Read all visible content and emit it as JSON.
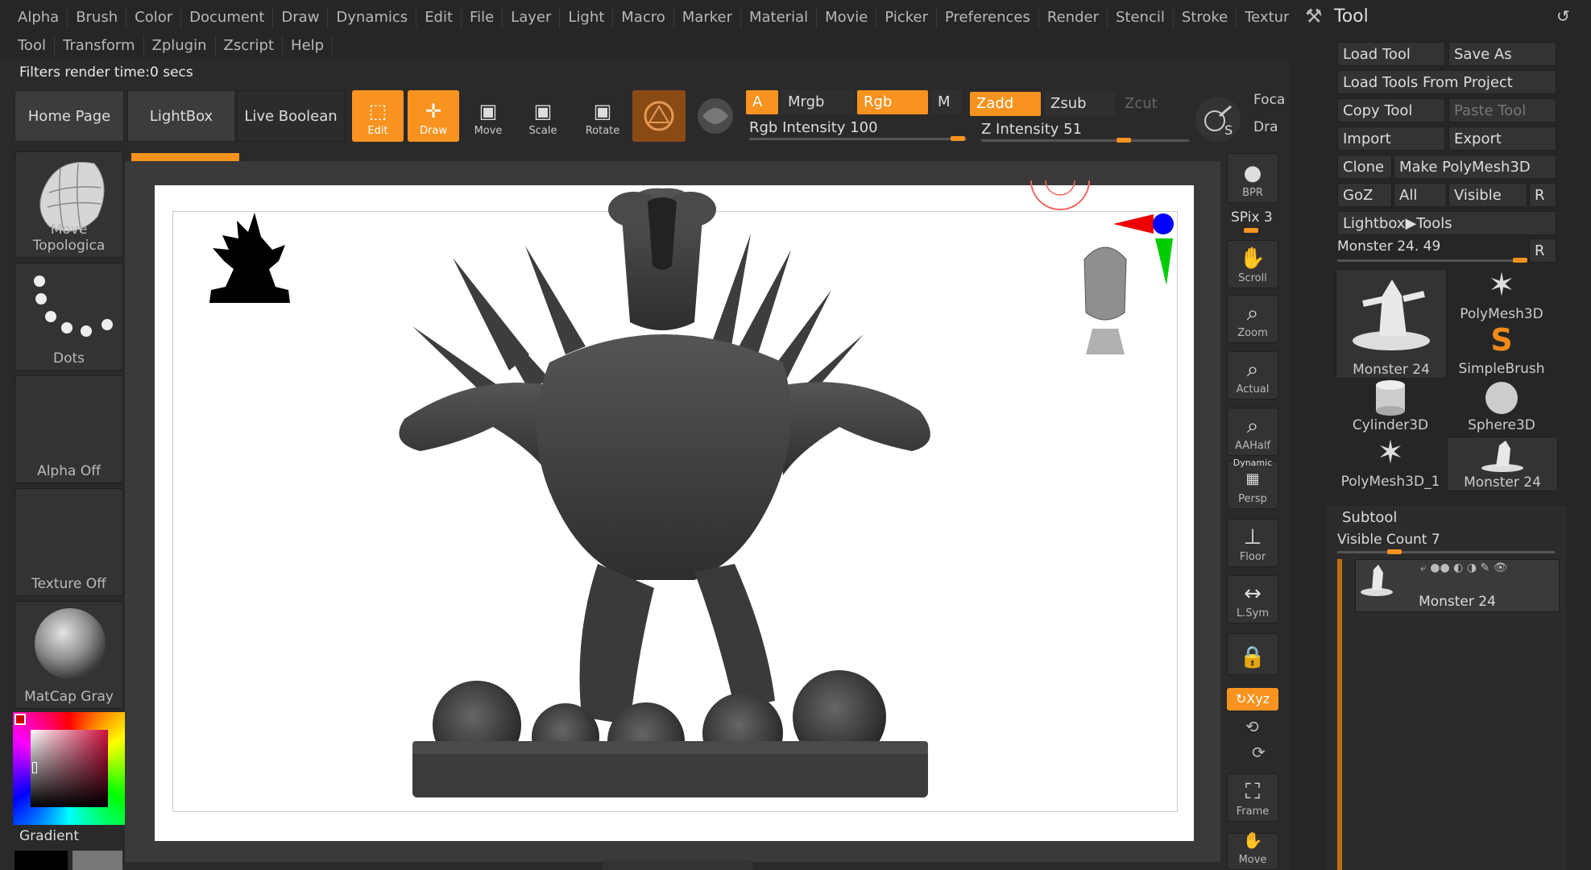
{
  "menu": {
    "row1": [
      "Alpha",
      "Brush",
      "Color",
      "Document",
      "Draw",
      "Dynamics",
      "Edit",
      "File",
      "Layer",
      "Light",
      "Macro",
      "Marker",
      "Material",
      "Movie",
      "Picker",
      "Preferences",
      "Render",
      "Stencil",
      "Stroke",
      "Texture"
    ],
    "row2": [
      "Tool",
      "Transform",
      "Zplugin",
      "Zscript",
      "Help"
    ]
  },
  "status": "Filters render time:0 secs",
  "shelf": {
    "home": "Home Page",
    "lightbox": "LightBox",
    "live_boolean": "Live Boolean",
    "edit": "Edit",
    "draw": "Draw",
    "move": "Move",
    "scale": "Scale",
    "rotate": "Rotate",
    "a": "A",
    "mrgb": "Mrgb",
    "rgb": "Rgb",
    "m": "M",
    "zadd": "Zadd",
    "zsub": "Zsub",
    "zcut": "Zcut",
    "rgb_intensity_label": "Rgb Intensity",
    "rgb_intensity": "100",
    "z_intensity_label": "Z Intensity",
    "z_intensity": "51",
    "focal": "Foca",
    "draw_size": "Dra",
    "s_label": "S"
  },
  "left": {
    "brush": "Move Topologica",
    "stroke": "Dots",
    "alpha": "Alpha Off",
    "texture": "Texture Off",
    "material": "MatCap Gray",
    "gradient": "Gradient"
  },
  "right_strip": {
    "bpr": "BPR",
    "spix_label": "SPix",
    "spix": "3",
    "scroll": "Scroll",
    "zoom": "Zoom",
    "actual": "Actual",
    "aahalf": "AAHalf",
    "dynamic": "Dynamic",
    "persp": "Persp",
    "floor": "Floor",
    "lsym": "L.Sym",
    "xyz": "Xyz",
    "frame": "Frame",
    "move": "Move"
  },
  "tool_palette": {
    "title": "Tool",
    "load_tool": "Load Tool",
    "save_as": "Save As",
    "load_from_project": "Load Tools From Project",
    "copy_tool": "Copy Tool",
    "paste_tool": "Paste Tool",
    "import": "Import",
    "export": "Export",
    "clone": "Clone",
    "make_polymesh": "Make PolyMesh3D",
    "goz": "GoZ",
    "all": "All",
    "visible": "Visible",
    "r": "R",
    "lightbox_tools": "Lightbox▶Tools",
    "current_tool": "Monster 24. 49",
    "thumbs": [
      "Monster 24",
      "PolyMesh3D",
      "SimpleBrush",
      "Cylinder3D",
      "Sphere3D",
      "PolyMesh3D_1",
      "Monster 24"
    ],
    "subtool_title": "Subtool",
    "visible_count_label": "Visible Count",
    "visible_count": "7",
    "subtool_item": "Monster 24"
  },
  "colors": {
    "accent": "#f7931e",
    "panel": "#333333",
    "bg": "#262626"
  }
}
